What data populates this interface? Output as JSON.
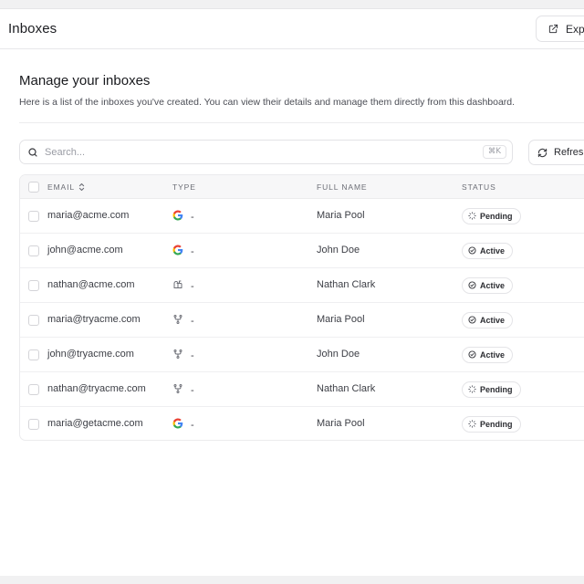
{
  "header": {
    "title": "Inboxes",
    "export_label": "Expo"
  },
  "page": {
    "heading": "Manage your inboxes",
    "subheading": "Here is a list of the inboxes you've created. You can view their details and manage them directly from this dashboard."
  },
  "toolbar": {
    "search_placeholder": "Search...",
    "search_shortcut": "⌘K",
    "refresh_label": "Refresh"
  },
  "table": {
    "columns": {
      "email": "EMAIL",
      "type": "TYPE",
      "full_name": "FULL NAME",
      "status": "STATUS"
    },
    "rows": [
      {
        "email": "maria@acme.com",
        "type_icon": "google-icon",
        "type_text": "-",
        "full_name": "Maria Pool",
        "status": "Pending"
      },
      {
        "email": "john@acme.com",
        "type_icon": "google-icon",
        "type_text": "-",
        "full_name": "John Doe",
        "status": "Active"
      },
      {
        "email": "nathan@acme.com",
        "type_icon": "mailbox-icon",
        "type_text": "-",
        "full_name": "Nathan Clark",
        "status": "Active"
      },
      {
        "email": "maria@tryacme.com",
        "type_icon": "branch-icon",
        "type_text": "-",
        "full_name": "Maria Pool",
        "status": "Active"
      },
      {
        "email": "john@tryacme.com",
        "type_icon": "branch-icon",
        "type_text": "-",
        "full_name": "John Doe",
        "status": "Active"
      },
      {
        "email": "nathan@tryacme.com",
        "type_icon": "branch-icon",
        "type_text": "-",
        "full_name": "Nathan Clark",
        "status": "Pending"
      },
      {
        "email": "maria@getacme.com",
        "type_icon": "google-icon",
        "type_text": "-",
        "full_name": "Maria Pool",
        "status": "Pending"
      }
    ]
  },
  "colors": {
    "background": "#f1f1f2",
    "surface": "#ffffff",
    "border": "#e3e3e6",
    "text": "#1f2024",
    "muted": "#6c6e76"
  }
}
